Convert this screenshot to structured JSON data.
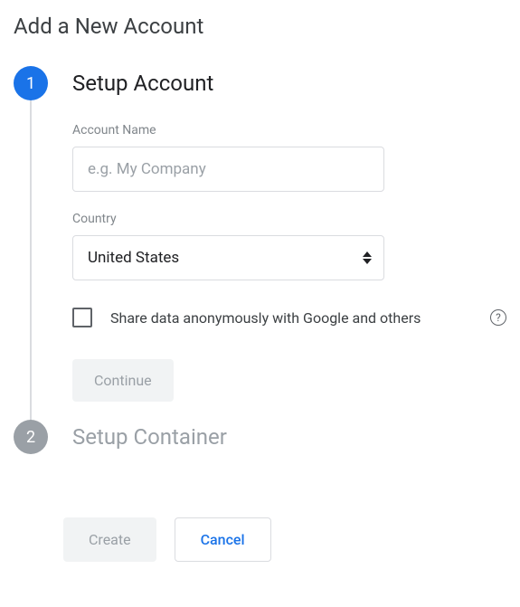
{
  "page": {
    "title": "Add a New Account"
  },
  "steps": {
    "step1": {
      "number": "1",
      "title": "Setup Account",
      "account_name_label": "Account Name",
      "account_name_placeholder": "e.g. My Company",
      "country_label": "Country",
      "country_value": "United States",
      "share_data_label": "Share data anonymously with Google and others",
      "continue_label": "Continue"
    },
    "step2": {
      "number": "2",
      "title": "Setup Container"
    }
  },
  "footer": {
    "create_label": "Create",
    "cancel_label": "Cancel"
  }
}
